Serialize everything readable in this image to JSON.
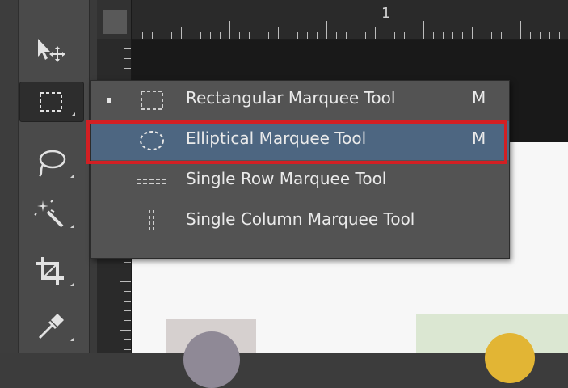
{
  "toolbar": {
    "tools": [
      {
        "name": "move-tool",
        "icon": "move-icon"
      },
      {
        "name": "rectangular-marquee-tool",
        "icon": "rectangular-marquee-icon",
        "active": true
      },
      {
        "name": "lasso-tool",
        "icon": "lasso-icon"
      },
      {
        "name": "magic-wand-tool",
        "icon": "magic-wand-icon"
      },
      {
        "name": "crop-tool",
        "icon": "crop-icon"
      },
      {
        "name": "eyedropper-tool",
        "icon": "eyedropper-icon"
      }
    ]
  },
  "ruler": {
    "top_number": "1"
  },
  "flyout": {
    "items": [
      {
        "label": "Rectangular Marquee Tool",
        "shortcut": "M",
        "icon": "rectangular-marquee-icon",
        "current": true
      },
      {
        "label": "Elliptical Marquee Tool",
        "shortcut": "M",
        "icon": "elliptical-marquee-icon",
        "highlighted": true
      },
      {
        "label": "Single Row Marquee Tool",
        "shortcut": "",
        "icon": "single-row-marquee-icon"
      },
      {
        "label": "Single Column Marquee Tool",
        "shortcut": "",
        "icon": "single-column-marquee-icon"
      }
    ]
  },
  "colors": {
    "highlight_border": "#d31f23",
    "menu_hover": "#4d6681",
    "menu_bg": "#535353",
    "toolbar_bg": "#4a4a4a"
  }
}
